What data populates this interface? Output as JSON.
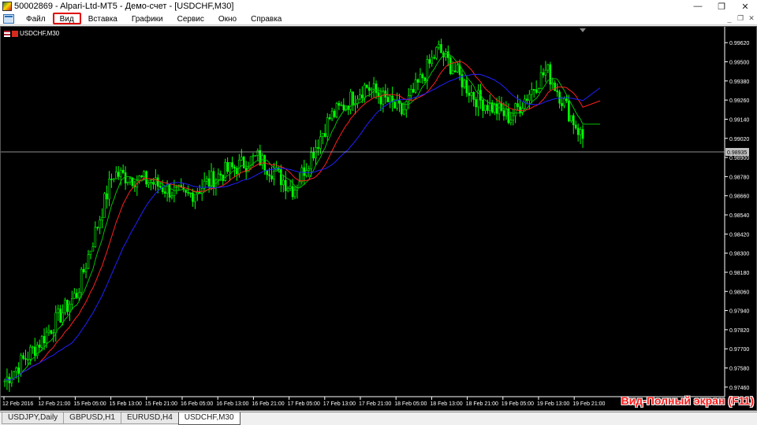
{
  "window": {
    "title": "50002869 - Alpari-Ltd-MT5 - Демо-счет - [USDCHF,M30]",
    "controls": [
      "—",
      "❐",
      "✕"
    ]
  },
  "menu": {
    "items": [
      "Файл",
      "Вид",
      "Вставка",
      "Графики",
      "Сервис",
      "Окно",
      "Справка"
    ],
    "highlighted": "Вид",
    "mdi_controls": [
      "_",
      "❐",
      "✕"
    ]
  },
  "chart": {
    "symbol_label": "USDCHF,M30",
    "current_price": "0.98935",
    "y_ticks": [
      "0.99620",
      "0.99500",
      "0.99380",
      "0.99260",
      "0.99140",
      "0.99020",
      "0.98900",
      "0.98780",
      "0.98660",
      "0.98540",
      "0.98420",
      "0.98300",
      "0.98180",
      "0.98060",
      "0.97940",
      "0.97820",
      "0.97700",
      "0.97580",
      "0.97460"
    ],
    "x_ticks": [
      "12 Feb 2016",
      "12 Feb 21:00",
      "15 Feb 05:00",
      "15 Feb 13:00",
      "15 Feb 21:00",
      "16 Feb 05:00",
      "16 Feb 13:00",
      "16 Feb 21:00",
      "17 Feb 05:00",
      "17 Feb 13:00",
      "17 Feb 21:00",
      "18 Feb 05:00",
      "18 Feb 13:00",
      "18 Feb 21:00",
      "19 Feb 05:00",
      "19 Feb 13:00",
      "19 Feb 21:00"
    ],
    "colors": {
      "candle": "#00ff00",
      "ma_fast": "#00c000",
      "ma_mid": "#ff2020",
      "ma_slow": "#2020ff",
      "hline": "#c0c0c0",
      "axis": "#ffffff"
    }
  },
  "chart_data": {
    "type": "line",
    "title": "USDCHF,M30",
    "x": [
      "12 Feb 2016",
      "12 Feb 21:00",
      "15 Feb 05:00",
      "15 Feb 13:00",
      "15 Feb 21:00",
      "16 Feb 05:00",
      "16 Feb 13:00",
      "16 Feb 21:00",
      "17 Feb 05:00",
      "17 Feb 13:00",
      "17 Feb 21:00",
      "18 Feb 05:00",
      "18 Feb 13:00",
      "18 Feb 21:00",
      "19 Feb 05:00",
      "19 Feb 13:00",
      "19 Feb 21:00"
    ],
    "series": [
      {
        "values": [
          0.975,
          0.9775,
          0.9805,
          0.988,
          0.9875,
          0.9865,
          0.988,
          0.989,
          0.987,
          0.9915,
          0.9935,
          0.9918,
          0.9958,
          0.9928,
          0.9915,
          0.9945,
          0.9902
        ]
      }
    ],
    "ylim": [
      0.974,
      0.997
    ],
    "current_price": 0.98935
  },
  "tabs": {
    "items": [
      "USDJPY,Daily",
      "GBPUSD,H1",
      "EURUSD,H4",
      "USDCHF,M30"
    ],
    "active": "USDCHF,M30"
  },
  "overlay": {
    "label": "Вид-Полный экран (F11)"
  }
}
